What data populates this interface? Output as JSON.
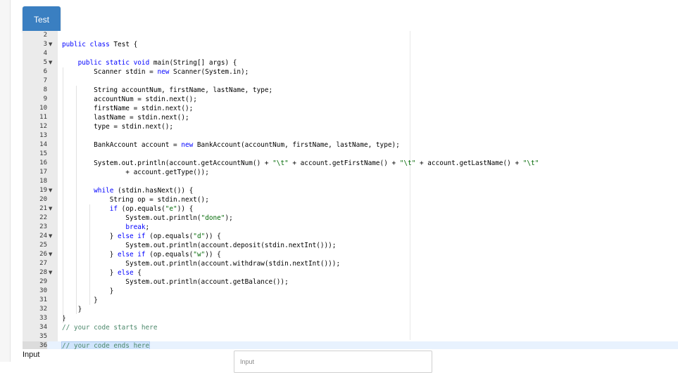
{
  "tab": {
    "label": "Test"
  },
  "editor": {
    "lines": [
      {
        "n": "2",
        "fold": false,
        "text": ""
      },
      {
        "n": "3",
        "fold": true,
        "text": "public class Test {"
      },
      {
        "n": "4",
        "fold": false,
        "text": ""
      },
      {
        "n": "5",
        "fold": true,
        "text": "    public static void main(String[] args) {"
      },
      {
        "n": "6",
        "fold": false,
        "text": "        Scanner stdin = new Scanner(System.in);"
      },
      {
        "n": "7",
        "fold": false,
        "text": ""
      },
      {
        "n": "8",
        "fold": false,
        "text": "        String accountNum, firstName, lastName, type;"
      },
      {
        "n": "9",
        "fold": false,
        "text": "        accountNum = stdin.next();"
      },
      {
        "n": "10",
        "fold": false,
        "text": "        firstName = stdin.next();"
      },
      {
        "n": "11",
        "fold": false,
        "text": "        lastName = stdin.next();"
      },
      {
        "n": "12",
        "fold": false,
        "text": "        type = stdin.next();"
      },
      {
        "n": "13",
        "fold": false,
        "text": ""
      },
      {
        "n": "14",
        "fold": false,
        "text": "        BankAccount account = new BankAccount(accountNum, firstName, lastName, type);"
      },
      {
        "n": "15",
        "fold": false,
        "text": ""
      },
      {
        "n": "16",
        "fold": false,
        "text": "        System.out.println(account.getAccountNum() + \"\\t\" + account.getFirstName() + \"\\t\" + account.getLastName() + \"\\t\""
      },
      {
        "n": "17",
        "fold": false,
        "text": "                + account.getType());"
      },
      {
        "n": "18",
        "fold": false,
        "text": ""
      },
      {
        "n": "19",
        "fold": true,
        "text": "        while (stdin.hasNext()) {"
      },
      {
        "n": "20",
        "fold": false,
        "text": "            String op = stdin.next();"
      },
      {
        "n": "21",
        "fold": true,
        "text": "            if (op.equals(\"e\")) {"
      },
      {
        "n": "22",
        "fold": false,
        "text": "                System.out.println(\"done\");"
      },
      {
        "n": "23",
        "fold": false,
        "text": "                break;"
      },
      {
        "n": "24",
        "fold": true,
        "text": "            } else if (op.equals(\"d\")) {"
      },
      {
        "n": "25",
        "fold": false,
        "text": "                System.out.println(account.deposit(stdin.nextInt()));"
      },
      {
        "n": "26",
        "fold": true,
        "text": "            } else if (op.equals(\"w\")) {"
      },
      {
        "n": "27",
        "fold": false,
        "text": "                System.out.println(account.withdraw(stdin.nextInt()));"
      },
      {
        "n": "28",
        "fold": true,
        "text": "            } else {"
      },
      {
        "n": "29",
        "fold": false,
        "text": "                System.out.println(account.getBalance());"
      },
      {
        "n": "30",
        "fold": false,
        "text": "            }"
      },
      {
        "n": "31",
        "fold": false,
        "text": "        }"
      },
      {
        "n": "32",
        "fold": false,
        "text": "    }"
      },
      {
        "n": "33",
        "fold": false,
        "text": "}"
      },
      {
        "n": "34",
        "fold": false,
        "text": "// your code starts here"
      },
      {
        "n": "35",
        "fold": false,
        "text": ""
      },
      {
        "n": "36",
        "fold": false,
        "text": "// your code ends here"
      }
    ],
    "active_line": "36"
  },
  "input": {
    "label": "Input",
    "box_label": "Input"
  },
  "colors": {
    "tab_bg": "#3a7fc1",
    "keyword": "#0000ff",
    "string": "#036a07",
    "comment": "#4c886b",
    "gutter": "#ebebeb"
  }
}
